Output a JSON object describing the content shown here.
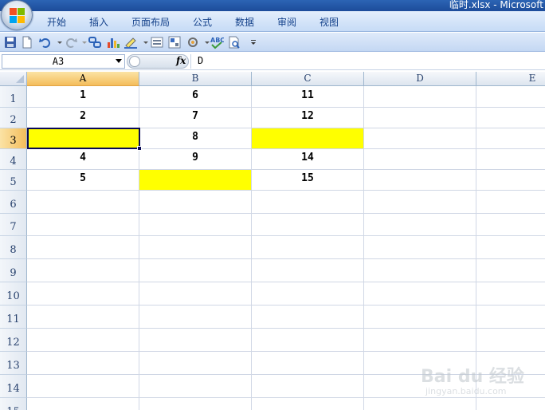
{
  "window": {
    "title": "临时.xlsx - Microsoft"
  },
  "ribbon": {
    "tabs": [
      "开始",
      "插入",
      "页面布局",
      "公式",
      "数据",
      "审阅",
      "视图"
    ]
  },
  "quick_access": {
    "icons": [
      "save-icon",
      "new-file-icon",
      "undo-icon",
      "redo-icon",
      "link-icon",
      "chart-icon",
      "highlight-icon",
      "form-icon",
      "properties-icon",
      "tools-icon",
      "spell-check-icon",
      "print-preview-icon",
      "customize-icon"
    ]
  },
  "formula_bar": {
    "name_box": "A3",
    "fx": "fx",
    "value": "D"
  },
  "sheet": {
    "columns": [
      "A",
      "B",
      "C",
      "D",
      "E"
    ],
    "active_column": "A",
    "rows": [
      "1",
      "2",
      "3",
      "4",
      "5",
      "6",
      "7",
      "8",
      "9",
      "10",
      "11",
      "12",
      "13",
      "14",
      "15"
    ],
    "active_row": "3",
    "active_cell": "A3",
    "yellow_fill_color": "#ffff00",
    "cells": {
      "A1": "1",
      "B1": "6",
      "C1": "11",
      "A2": "2",
      "B2": "7",
      "C2": "12",
      "A3": "",
      "B3": "8",
      "C3": "",
      "A4": "4",
      "B4": "9",
      "C4": "14",
      "A5": "5",
      "B5": "",
      "C5": "15"
    },
    "yellow_cells": [
      "A3",
      "C3",
      "B5"
    ]
  },
  "watermark": {
    "main": "Bai du 经验",
    "sub": "jingyan.baidu.com"
  }
}
